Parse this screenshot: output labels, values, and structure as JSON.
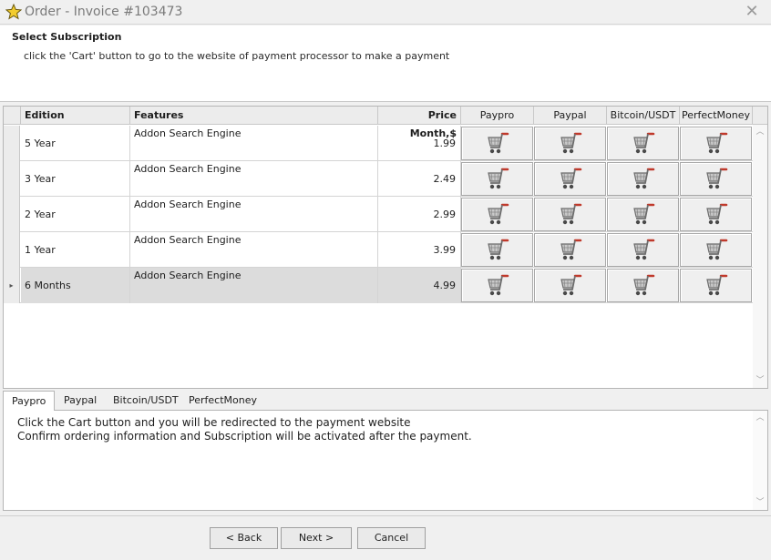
{
  "window": {
    "title": "Order - Invoice #103473",
    "title_icon": "star-icon",
    "close_icon": "close-icon"
  },
  "header": {
    "title": "Select Subscription",
    "description": "click the 'Cart' button to go to the website of payment processor to make a payment"
  },
  "grid": {
    "columns": {
      "edition": "Edition",
      "features": "Features",
      "price": "Price Month,$",
      "paypro": "Paypro",
      "paypal": "Paypal",
      "bitcoin": "Bitcoin/USDT",
      "perfectmoney": "PerfectMoney"
    },
    "rows": [
      {
        "edition": "5 Year",
        "features": "Addon Search Engine",
        "price": "1.99"
      },
      {
        "edition": "3 Year",
        "features": "Addon Search Engine",
        "price": "2.49"
      },
      {
        "edition": "2 Year",
        "features": "Addon Search Engine",
        "price": "2.99"
      },
      {
        "edition": "1 Year",
        "features": "Addon Search Engine",
        "price": "3.99"
      },
      {
        "edition": "6 Months",
        "features": "Addon Search Engine",
        "price": "4.99",
        "selected": true
      }
    ],
    "cart_icon": "shopping-cart-icon",
    "selected_marker": "▸"
  },
  "tabs": {
    "items": [
      "Paypro",
      "Paypal",
      "Bitcoin/USDT",
      "PerfectMoney"
    ],
    "active": "Paypro",
    "content": {
      "line1": "Click the Cart button and you will be redirected to the payment website",
      "line2": "Confirm ordering information and Subscription will be activated after the payment."
    }
  },
  "footer": {
    "back": "< Back",
    "next": "Next >",
    "cancel": "Cancel"
  },
  "colors": {
    "cart_handle": "#c0392b",
    "selected_row": "#dcdcdc",
    "title_star": "#e8c21a"
  }
}
